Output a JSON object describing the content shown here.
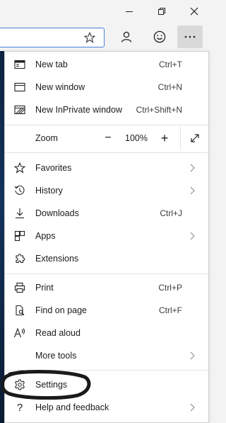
{
  "window": {
    "controls": [
      {
        "name": "minimize-icon"
      },
      {
        "name": "maximize-icon"
      },
      {
        "name": "close-icon"
      }
    ]
  },
  "toolbar": {
    "favorite_icon": "star-outline-icon",
    "profile_icon": "profile-icon",
    "feedback_icon": "smiley-icon",
    "more_icon": "ellipsis-icon"
  },
  "menu": {
    "items": [
      {
        "label": "New tab",
        "shortcut": "Ctrl+T",
        "icon": "new-tab-icon"
      },
      {
        "label": "New window",
        "shortcut": "Ctrl+N",
        "icon": "new-window-icon"
      },
      {
        "label": "New InPrivate window",
        "shortcut": "Ctrl+Shift+N",
        "icon": "inprivate-icon"
      },
      {
        "label": "Zoom",
        "icon": ""
      },
      {
        "label": "Favorites",
        "shortcut": "",
        "icon": "star-icon",
        "submenu": true
      },
      {
        "label": "History",
        "shortcut": "",
        "icon": "history-icon",
        "submenu": true
      },
      {
        "label": "Downloads",
        "shortcut": "Ctrl+J",
        "icon": "download-icon"
      },
      {
        "label": "Apps",
        "shortcut": "",
        "icon": "apps-icon",
        "submenu": true
      },
      {
        "label": "Extensions",
        "shortcut": "",
        "icon": "extensions-icon"
      },
      {
        "label": "Print",
        "shortcut": "Ctrl+P",
        "icon": "print-icon"
      },
      {
        "label": "Find on page",
        "shortcut": "Ctrl+F",
        "icon": "find-icon"
      },
      {
        "label": "Read aloud",
        "shortcut": "",
        "icon": "read-aloud-icon"
      },
      {
        "label": "More tools",
        "shortcut": "",
        "icon": "",
        "submenu": true
      },
      {
        "label": "Settings",
        "shortcut": "",
        "icon": "gear-icon"
      },
      {
        "label": "Help and feedback",
        "shortcut": "",
        "icon": "help-icon",
        "submenu": true
      }
    ],
    "zoom": {
      "minus": "−",
      "value": "100%",
      "plus": "+"
    }
  },
  "colors": {
    "accent": "#4a7fd6",
    "menu_bg": "#ffffff",
    "chrome_bg": "#f3f3f3",
    "annotation": "#1a1a1a"
  }
}
